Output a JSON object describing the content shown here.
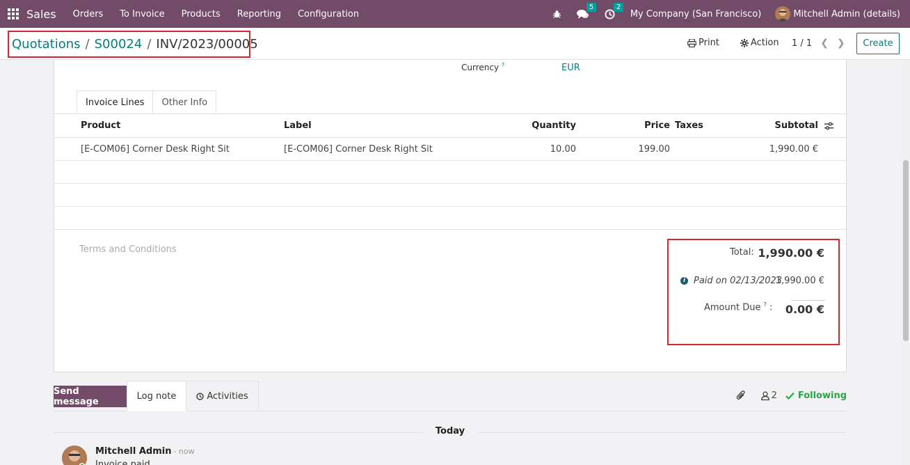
{
  "navbar": {
    "app_name": "Sales",
    "menu": [
      "Orders",
      "To Invoice",
      "Products",
      "Reporting",
      "Configuration"
    ],
    "messages_count": "5",
    "activities_count": "2",
    "company": "My Company (San Francisco)",
    "user": "Mitchell Admin (details)"
  },
  "breadcrumb": {
    "items": [
      "Quotations",
      "S00024"
    ],
    "current": "INV/2023/00005"
  },
  "control": {
    "print_label": "Print",
    "action_label": "Action",
    "pager": "1 / 1",
    "create_label": "Create"
  },
  "form": {
    "currency_label": "Currency",
    "currency_help": "?",
    "currency_value": "EUR",
    "tabs": [
      "Invoice Lines",
      "Other Info"
    ],
    "columns": {
      "product": "Product",
      "label": "Label",
      "quantity": "Quantity",
      "price": "Price",
      "taxes": "Taxes",
      "subtotal": "Subtotal"
    },
    "lines": [
      {
        "product": "[E-COM06] Corner Desk Right Sit",
        "label": "[E-COM06] Corner Desk Right Sit",
        "quantity": "10.00",
        "price": "199.00",
        "taxes": "",
        "subtotal": "1,990.00 €"
      }
    ],
    "terms_placeholder": "Terms and Conditions"
  },
  "totals": {
    "total_label": "Total:",
    "total_value": "1,990.00 €",
    "paid_text": "Paid on 02/13/2023",
    "paid_value": "1,990.00 €",
    "amount_due_label": "Amount Due",
    "amount_due_help": "?",
    "amount_due_colon": ":",
    "amount_due_value": "0.00 €"
  },
  "chatter": {
    "send_message": "Send message",
    "log_note": "Log note",
    "activities": "Activities",
    "followers_count": "2",
    "following": "Following",
    "date_separator": "Today",
    "message": {
      "author": "Mitchell Admin",
      "time": "- now",
      "body": "Invoice paid"
    }
  },
  "colors": {
    "brand": "#714b67",
    "accent": "#017e84",
    "highlight": "#d9232e"
  }
}
